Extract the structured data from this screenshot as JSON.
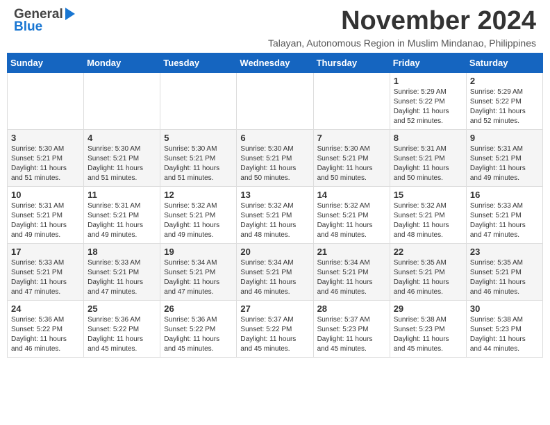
{
  "header": {
    "logo": {
      "line1": "General",
      "line2": "Blue",
      "alt": "GeneralBlue logo"
    },
    "title": "November 2024",
    "subtitle": "Talayan, Autonomous Region in Muslim Mindanao, Philippines"
  },
  "weekdays": [
    "Sunday",
    "Monday",
    "Tuesday",
    "Wednesday",
    "Thursday",
    "Friday",
    "Saturday"
  ],
  "weeks": [
    [
      {
        "day": "",
        "info": ""
      },
      {
        "day": "",
        "info": ""
      },
      {
        "day": "",
        "info": ""
      },
      {
        "day": "",
        "info": ""
      },
      {
        "day": "",
        "info": ""
      },
      {
        "day": "1",
        "info": "Sunrise: 5:29 AM\nSunset: 5:22 PM\nDaylight: 11 hours\nand 52 minutes."
      },
      {
        "day": "2",
        "info": "Sunrise: 5:29 AM\nSunset: 5:22 PM\nDaylight: 11 hours\nand 52 minutes."
      }
    ],
    [
      {
        "day": "3",
        "info": "Sunrise: 5:30 AM\nSunset: 5:21 PM\nDaylight: 11 hours\nand 51 minutes."
      },
      {
        "day": "4",
        "info": "Sunrise: 5:30 AM\nSunset: 5:21 PM\nDaylight: 11 hours\nand 51 minutes."
      },
      {
        "day": "5",
        "info": "Sunrise: 5:30 AM\nSunset: 5:21 PM\nDaylight: 11 hours\nand 51 minutes."
      },
      {
        "day": "6",
        "info": "Sunrise: 5:30 AM\nSunset: 5:21 PM\nDaylight: 11 hours\nand 50 minutes."
      },
      {
        "day": "7",
        "info": "Sunrise: 5:30 AM\nSunset: 5:21 PM\nDaylight: 11 hours\nand 50 minutes."
      },
      {
        "day": "8",
        "info": "Sunrise: 5:31 AM\nSunset: 5:21 PM\nDaylight: 11 hours\nand 50 minutes."
      },
      {
        "day": "9",
        "info": "Sunrise: 5:31 AM\nSunset: 5:21 PM\nDaylight: 11 hours\nand 49 minutes."
      }
    ],
    [
      {
        "day": "10",
        "info": "Sunrise: 5:31 AM\nSunset: 5:21 PM\nDaylight: 11 hours\nand 49 minutes."
      },
      {
        "day": "11",
        "info": "Sunrise: 5:31 AM\nSunset: 5:21 PM\nDaylight: 11 hours\nand 49 minutes."
      },
      {
        "day": "12",
        "info": "Sunrise: 5:32 AM\nSunset: 5:21 PM\nDaylight: 11 hours\nand 49 minutes."
      },
      {
        "day": "13",
        "info": "Sunrise: 5:32 AM\nSunset: 5:21 PM\nDaylight: 11 hours\nand 48 minutes."
      },
      {
        "day": "14",
        "info": "Sunrise: 5:32 AM\nSunset: 5:21 PM\nDaylight: 11 hours\nand 48 minutes."
      },
      {
        "day": "15",
        "info": "Sunrise: 5:32 AM\nSunset: 5:21 PM\nDaylight: 11 hours\nand 48 minutes."
      },
      {
        "day": "16",
        "info": "Sunrise: 5:33 AM\nSunset: 5:21 PM\nDaylight: 11 hours\nand 47 minutes."
      }
    ],
    [
      {
        "day": "17",
        "info": "Sunrise: 5:33 AM\nSunset: 5:21 PM\nDaylight: 11 hours\nand 47 minutes."
      },
      {
        "day": "18",
        "info": "Sunrise: 5:33 AM\nSunset: 5:21 PM\nDaylight: 11 hours\nand 47 minutes."
      },
      {
        "day": "19",
        "info": "Sunrise: 5:34 AM\nSunset: 5:21 PM\nDaylight: 11 hours\nand 47 minutes."
      },
      {
        "day": "20",
        "info": "Sunrise: 5:34 AM\nSunset: 5:21 PM\nDaylight: 11 hours\nand 46 minutes."
      },
      {
        "day": "21",
        "info": "Sunrise: 5:34 AM\nSunset: 5:21 PM\nDaylight: 11 hours\nand 46 minutes."
      },
      {
        "day": "22",
        "info": "Sunrise: 5:35 AM\nSunset: 5:21 PM\nDaylight: 11 hours\nand 46 minutes."
      },
      {
        "day": "23",
        "info": "Sunrise: 5:35 AM\nSunset: 5:21 PM\nDaylight: 11 hours\nand 46 minutes."
      }
    ],
    [
      {
        "day": "24",
        "info": "Sunrise: 5:36 AM\nSunset: 5:22 PM\nDaylight: 11 hours\nand 46 minutes."
      },
      {
        "day": "25",
        "info": "Sunrise: 5:36 AM\nSunset: 5:22 PM\nDaylight: 11 hours\nand 45 minutes."
      },
      {
        "day": "26",
        "info": "Sunrise: 5:36 AM\nSunset: 5:22 PM\nDaylight: 11 hours\nand 45 minutes."
      },
      {
        "day": "27",
        "info": "Sunrise: 5:37 AM\nSunset: 5:22 PM\nDaylight: 11 hours\nand 45 minutes."
      },
      {
        "day": "28",
        "info": "Sunrise: 5:37 AM\nSunset: 5:23 PM\nDaylight: 11 hours\nand 45 minutes."
      },
      {
        "day": "29",
        "info": "Sunrise: 5:38 AM\nSunset: 5:23 PM\nDaylight: 11 hours\nand 45 minutes."
      },
      {
        "day": "30",
        "info": "Sunrise: 5:38 AM\nSunset: 5:23 PM\nDaylight: 11 hours\nand 44 minutes."
      }
    ]
  ]
}
